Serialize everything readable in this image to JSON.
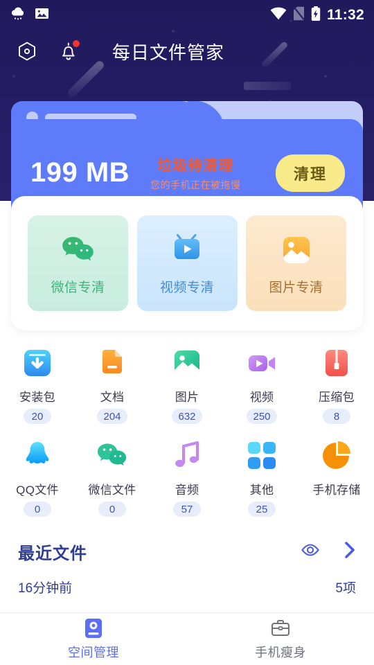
{
  "status_bar": {
    "time": "11:32",
    "left_icons": [
      "weather-cloud-icon",
      "screenshot-image-icon"
    ],
    "right_icons": [
      "wifi-icon",
      "no-sim-icon",
      "battery-charging-icon"
    ]
  },
  "app_bar": {
    "title": "每日文件管家",
    "settings_icon": "hexagon-settings-icon",
    "notification_icon": "bell-icon",
    "notification_badge": true
  },
  "storage_card": {
    "size_value": "199 MB",
    "junk_title": "垃圾待清理",
    "junk_subtitle": "您的手机正在被拖慢",
    "clean_button": "清理",
    "card_color": "#5e7cfa",
    "button_color": "#faeb8a",
    "junk_title_color": "#f2592c"
  },
  "shortcuts": [
    {
      "label": "微信专清",
      "icon": "wechat-icon",
      "color": "#37b779"
    },
    {
      "label": "视频专清",
      "icon": "video-tv-icon",
      "color": "#3d8fe0"
    },
    {
      "label": "图片专清",
      "icon": "picture-icon",
      "color": "#a4712c"
    }
  ],
  "categories_row1": [
    {
      "label": "安装包",
      "count": "20",
      "icon": "apk-download-icon"
    },
    {
      "label": "文档",
      "count": "204",
      "icon": "document-icon"
    },
    {
      "label": "图片",
      "count": "632",
      "icon": "image-icon"
    },
    {
      "label": "视频",
      "count": "250",
      "icon": "video-camera-icon"
    },
    {
      "label": "压缩包",
      "count": "8",
      "icon": "zip-archive-icon"
    }
  ],
  "categories_row2": [
    {
      "label": "QQ文件",
      "count": "0",
      "icon": "qq-penguin-icon"
    },
    {
      "label": "微信文件",
      "count": "0",
      "icon": "wechat-icon"
    },
    {
      "label": "音频",
      "count": "57",
      "icon": "music-note-icon"
    },
    {
      "label": "其他",
      "count": "25",
      "icon": "grid-other-icon"
    },
    {
      "label": "手机存储",
      "count": "",
      "icon": "pie-chart-storage-icon"
    }
  ],
  "recent": {
    "title": "最近文件",
    "eye_icon": "eye-icon",
    "chevron_icon": "chevron-right-icon",
    "when": "16分钟前",
    "count": "5项"
  },
  "bottom_nav": [
    {
      "label": "空间管理",
      "icon": "storage-disk-icon",
      "active": true
    },
    {
      "label": "手机瘦身",
      "icon": "briefcase-icon",
      "active": false
    }
  ]
}
